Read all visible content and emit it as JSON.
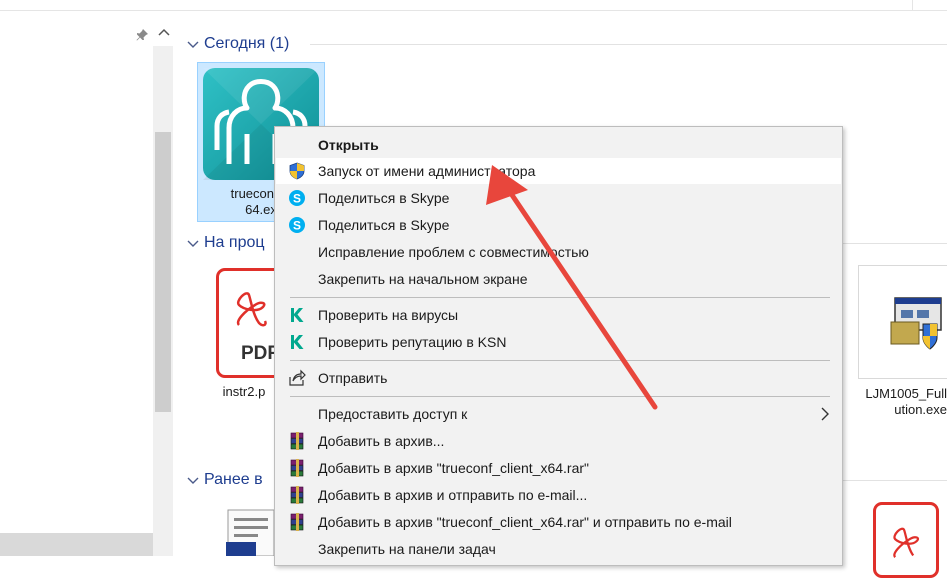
{
  "groups": [
    {
      "label": "Сегодня (1)"
    },
    {
      "label": "На проц"
    },
    {
      "label": "Ранее в"
    }
  ],
  "files": {
    "selected": {
      "line1": "trueconf_c",
      "line2": "64.ex"
    },
    "pdf": {
      "label": "instr2.p",
      "badge": "PDF"
    },
    "installer": {
      "line1": "LJM1005_Full",
      "line2": "ution.exe"
    }
  },
  "context_menu": {
    "items": [
      {
        "label": "Открыть",
        "icon": "none"
      },
      {
        "label": "Запуск от имени администратора",
        "icon": "uac-shield-icon"
      },
      {
        "label": "Поделиться в Skype",
        "icon": "skype-icon"
      },
      {
        "label": "Поделиться в Skype",
        "icon": "skype-icon"
      },
      {
        "label": "Исправление проблем с совместимостью",
        "icon": "none"
      },
      {
        "label": "Закрепить на начальном экране",
        "icon": "none"
      },
      {
        "label": "Проверить на вирусы",
        "icon": "kaspersky-icon"
      },
      {
        "label": "Проверить репутацию в KSN",
        "icon": "kaspersky-icon"
      },
      {
        "label": "Отправить",
        "icon": "share-icon"
      },
      {
        "label": "Предоставить доступ к",
        "icon": "none"
      },
      {
        "label": "Добавить в архив...",
        "icon": "winrar-icon"
      },
      {
        "label": "Добавить в архив \"trueconf_client_x64.rar\"",
        "icon": "winrar-icon"
      },
      {
        "label": "Добавить в архив и отправить по e-mail...",
        "icon": "winrar-icon"
      },
      {
        "label": "Добавить в архив \"trueconf_client_x64.rar\" и отправить по e-mail",
        "icon": "winrar-icon"
      },
      {
        "label": "Закрепить на панели задач",
        "icon": "none"
      }
    ],
    "highlighted_index": 1
  },
  "colors": {
    "header_blue": "#1e3d8f",
    "selection_fill": "#cce8ff",
    "trueconf_teal": "#17a2a8",
    "annotation_red": "#e8463c",
    "pdf_red": "#e0302a",
    "skype_blue": "#00aff0",
    "kaspersky_green": "#00a88e"
  }
}
